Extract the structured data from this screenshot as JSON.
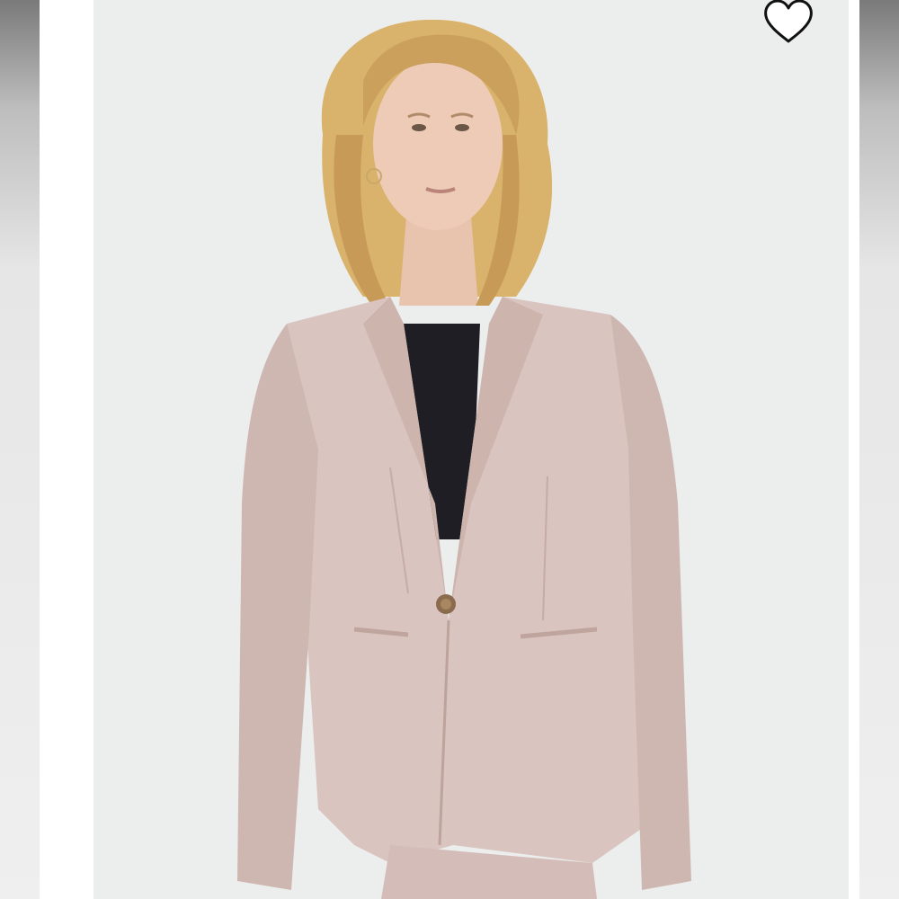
{
  "listing": {
    "photo_subject": "model",
    "garment_color": "#d9c4bf",
    "background_color": "#eceeee"
  },
  "actions": {
    "favorite_icon": "heart-outline-icon"
  }
}
